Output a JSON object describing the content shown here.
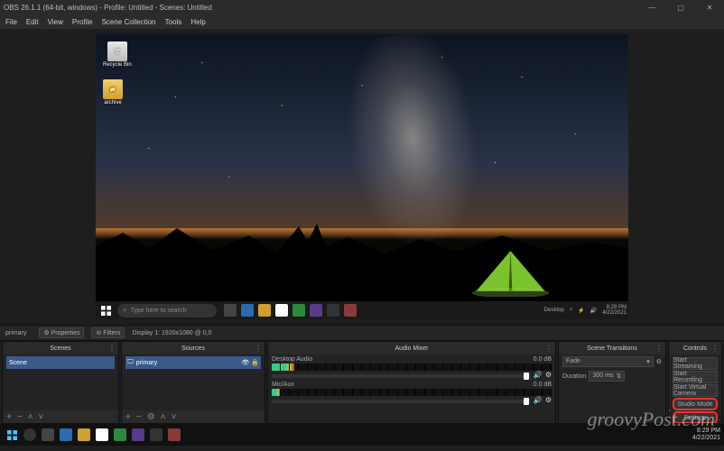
{
  "titlebar": {
    "title": "OBS 26.1.1 (64-bit, windows) - Profile: Untitled - Scenes: Untitled"
  },
  "menu": {
    "items": [
      "File",
      "Edit",
      "View",
      "Profile",
      "Scene Collection",
      "Tools",
      "Help"
    ]
  },
  "desktop_icons": {
    "recycle": "Recycle Bin",
    "archive": "archive"
  },
  "win_search": {
    "placeholder": "Type here to search"
  },
  "win_tray": {
    "label": "Desktop",
    "time": "8:29 PM",
    "date": "4/22/2021"
  },
  "toolbar": {
    "label": "primary",
    "properties": "Properties",
    "filters": "Filters",
    "display": "Display 1: 1920x1080 @ 0,0"
  },
  "panels": {
    "scenes": {
      "title": "Scenes",
      "items": [
        "Scene"
      ]
    },
    "sources": {
      "title": "Sources",
      "items": [
        {
          "label": "primary"
        }
      ]
    },
    "mixer": {
      "title": "Audio Mixer",
      "channels": [
        {
          "name": "Desktop Audio",
          "db": "0.0 dB"
        },
        {
          "name": "Mic/Aux",
          "db": "0.0 dB"
        }
      ]
    },
    "trans": {
      "title": "Scene Transitions",
      "fade": "Fade",
      "durationLabel": "Duration",
      "durationVal": "300 ms"
    },
    "controls": {
      "title": "Controls",
      "buttons": [
        "Start Streaming",
        "Start Recording",
        "Start Virtual Camera",
        "Studio Mode",
        "Settings"
      ]
    }
  },
  "outer_taskbar": {
    "time": "8:29 PM",
    "date": "4/22/2021"
  },
  "watermark": "groovyPost.com"
}
